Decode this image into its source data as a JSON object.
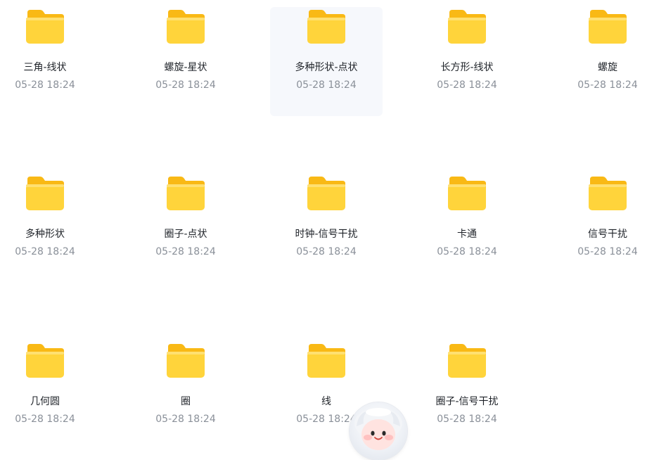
{
  "folders": [
    {
      "name": "三角-线状",
      "date": "05-28 18:24"
    },
    {
      "name": "螺旋-星状",
      "date": "05-28 18:24"
    },
    {
      "name": "多种形状-点状",
      "date": "05-28 18:24"
    },
    {
      "name": "长方形-线状",
      "date": "05-28 18:24"
    },
    {
      "name": "螺旋",
      "date": "05-28 18:24"
    },
    {
      "name": "多种形状",
      "date": "05-28 18:24"
    },
    {
      "name": "圈子-点状",
      "date": "05-28 18:24"
    },
    {
      "name": "时钟-信号干扰",
      "date": "05-28 18:24"
    },
    {
      "name": "卡通",
      "date": "05-28 18:24"
    },
    {
      "name": "信号干扰",
      "date": "05-28 18:24"
    },
    {
      "name": "几何圆",
      "date": "05-28 18:24"
    },
    {
      "name": "圈",
      "date": "05-28 18:24"
    },
    {
      "name": "线",
      "date": "05-28 18:24"
    },
    {
      "name": "圈子-信号干扰",
      "date": "05-28 18:24"
    }
  ],
  "icons": {
    "folder": "folder-icon",
    "assistant": "assistant-avatar-icon"
  },
  "colors": {
    "folder_front": "#ffd43b",
    "folder_back": "#f9b915",
    "hover_background": "#f6f8fc",
    "name_text": "#1f2329",
    "date_text": "#8a9099"
  }
}
